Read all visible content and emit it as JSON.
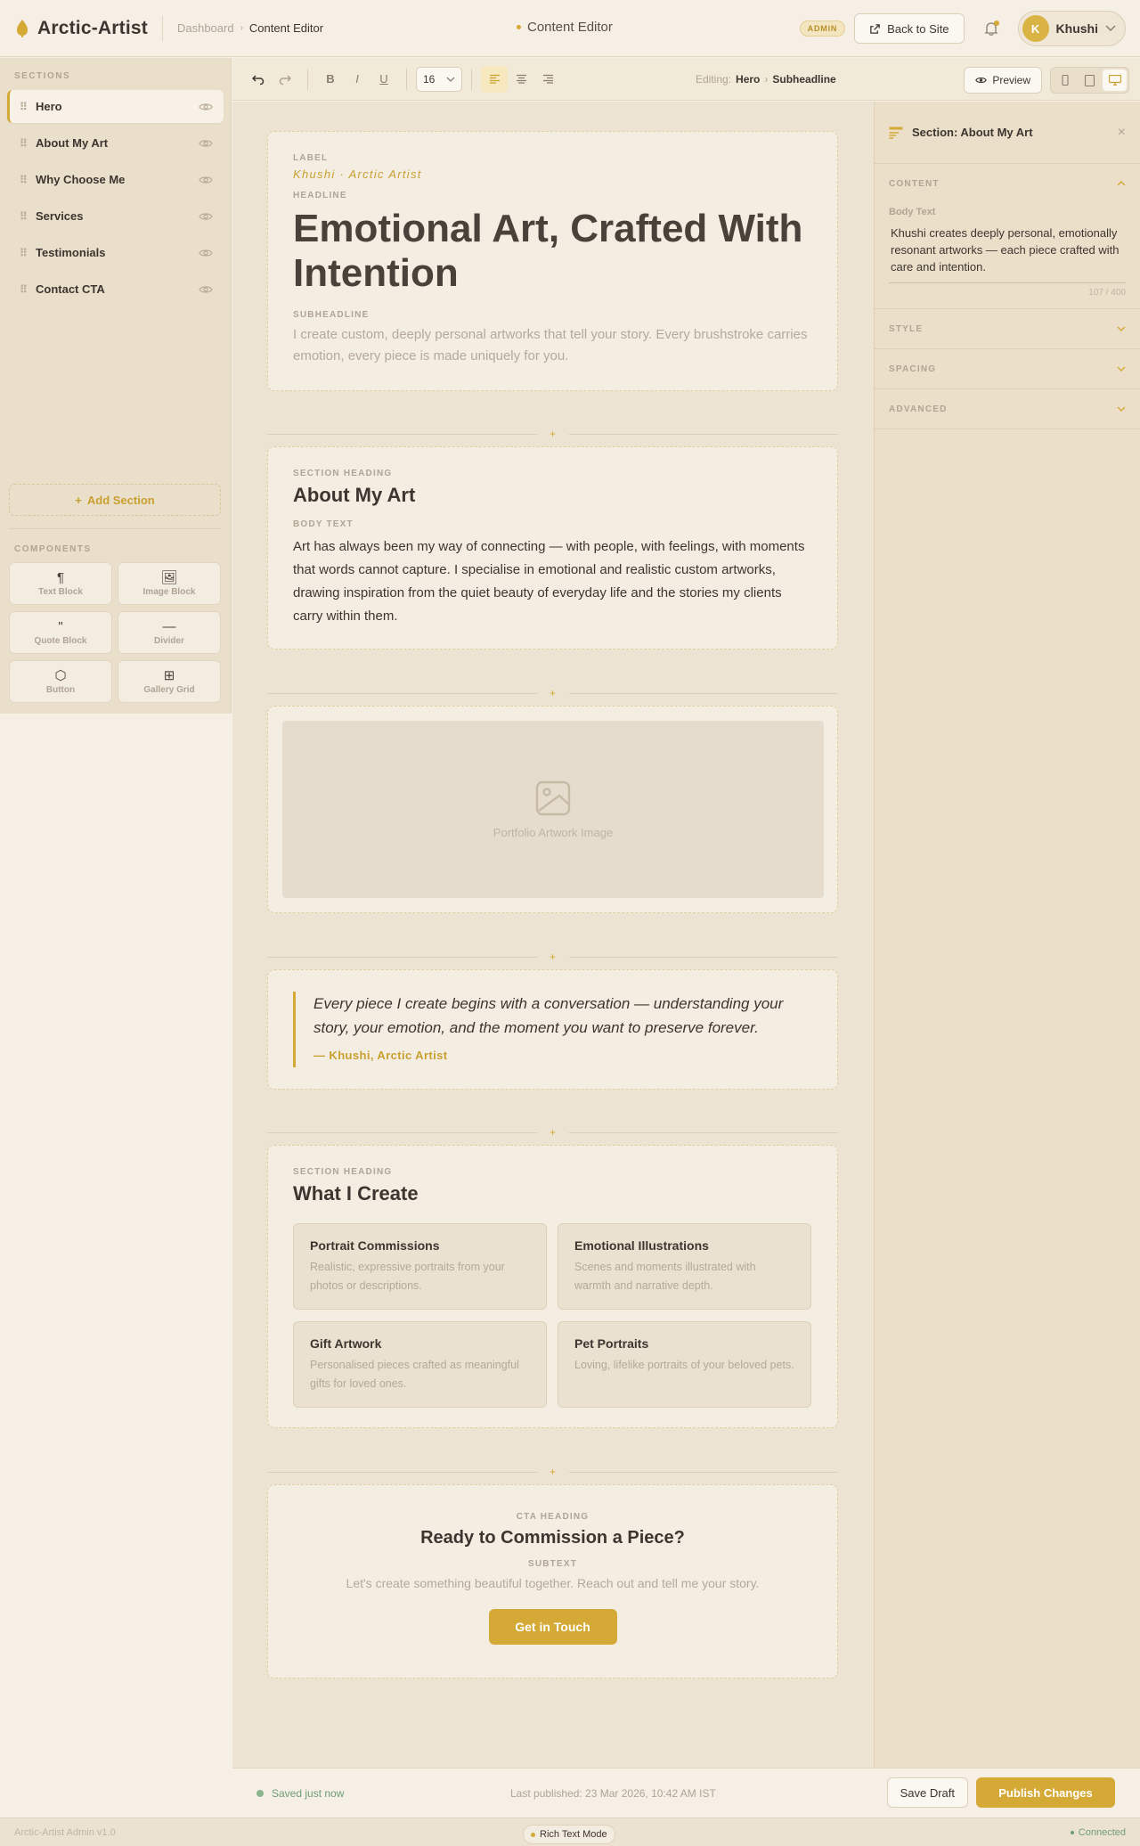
{
  "app": {
    "name": "Arctic-Artist",
    "version_text": "Arctic-Artist Admin v1.0"
  },
  "header": {
    "breadcrumb": [
      "Dashboard",
      "Content Editor"
    ],
    "center_title": "Content Editor",
    "admin_badge": "ADMIN",
    "back_to_site": "Back to Site",
    "user_initial": "K",
    "user_name": "Khushi"
  },
  "sidebar": {
    "sections_title": "SECTIONS",
    "sections": [
      {
        "label": "Hero",
        "active": true
      },
      {
        "label": "About My Art",
        "active": false
      },
      {
        "label": "Why Choose Me",
        "active": false
      },
      {
        "label": "Services",
        "active": false
      },
      {
        "label": "Testimonials",
        "active": false
      },
      {
        "label": "Contact CTA",
        "active": false
      }
    ],
    "add_section": "Add Section",
    "components_title": "COMPONENTS",
    "components": [
      {
        "label": "Text Block",
        "icon": "paragraph-icon",
        "glyph": "¶"
      },
      {
        "label": "Image Block",
        "icon": "image-icon",
        "glyph": "🖼"
      },
      {
        "label": "Quote Block",
        "icon": "quote-icon",
        "glyph": "\""
      },
      {
        "label": "Divider",
        "icon": "divider-icon",
        "glyph": "—"
      },
      {
        "label": "Button",
        "icon": "button-icon",
        "glyph": "⬡"
      },
      {
        "label": "Gallery Grid",
        "icon": "grid-icon",
        "glyph": "⊞"
      }
    ]
  },
  "toolbar": {
    "font_size": "16",
    "editing_prefix": "Editing:",
    "editing_section": "Hero",
    "editing_field": "Subheadline",
    "preview": "Preview"
  },
  "canvas": {
    "hero": {
      "label_title": "LABEL",
      "label_value": "Khushi · Arctic Artist",
      "headline_title": "HEADLINE",
      "headline": "Emotional Art, Crafted With Intention",
      "subheadline_title": "SUBHEADLINE",
      "subheadline": "I create custom, deeply personal artworks that tell your story. Every brushstroke carries emotion, every piece is made uniquely for you."
    },
    "about": {
      "heading_title": "SECTION HEADING",
      "heading": "About My Art",
      "body_title": "BODY TEXT",
      "body": "Art has always been my way of connecting — with people, with feelings, with moments that words cannot capture. I specialise in emotional and realistic custom artworks, drawing inspiration from the quiet beauty of everyday life and the stories my clients carry within them."
    },
    "image": {
      "caption": "Portfolio Artwork Image"
    },
    "quote": {
      "text": "Every piece I create begins with a conversation — understanding your story, your emotion, and the moment you want to preserve forever.",
      "author": "— Khushi, Arctic Artist"
    },
    "services": {
      "heading_title": "SECTION HEADING",
      "heading": "What I Create",
      "items": [
        {
          "title": "Portrait Commissions",
          "desc": "Realistic, expressive portraits from your photos or descriptions."
        },
        {
          "title": "Emotional Illustrations",
          "desc": "Scenes and moments illustrated with warmth and narrative depth."
        },
        {
          "title": "Gift Artwork",
          "desc": "Personalised pieces crafted as meaningful gifts for loved ones."
        },
        {
          "title": "Pet Portraits",
          "desc": "Loving, lifelike portraits of your beloved pets."
        }
      ]
    },
    "cta": {
      "heading_title": "CTA HEADING",
      "heading": "Ready to Commission a Piece?",
      "subtext_title": "SUBTEXT",
      "subtext": "Let's create something beautiful together. Reach out and tell me your story.",
      "button": "Get in Touch"
    }
  },
  "right_panel": {
    "title": "Section: About My Art",
    "content_title": "CONTENT",
    "body_label": "Body Text",
    "body_value": "Khushi creates deeply personal, emotionally resonant artworks — each piece crafted with care and intention.",
    "char_count": "107 / 400",
    "style_title": "STYLE",
    "spacing_title": "SPACING",
    "advanced_title": "ADVANCED"
  },
  "footer": {
    "saved": "Saved just now",
    "last_published": "Last published: 23 Mar 2026, 10:42 AM IST",
    "save_draft": "Save Draft",
    "publish": "Publish Changes"
  },
  "statusbar": {
    "mode": "Rich Text Mode",
    "connection": "Connected"
  },
  "colors": {
    "accent": "#d4a935",
    "text": "#3d3530",
    "muted": "#b0a494",
    "success": "#6e9e72"
  }
}
